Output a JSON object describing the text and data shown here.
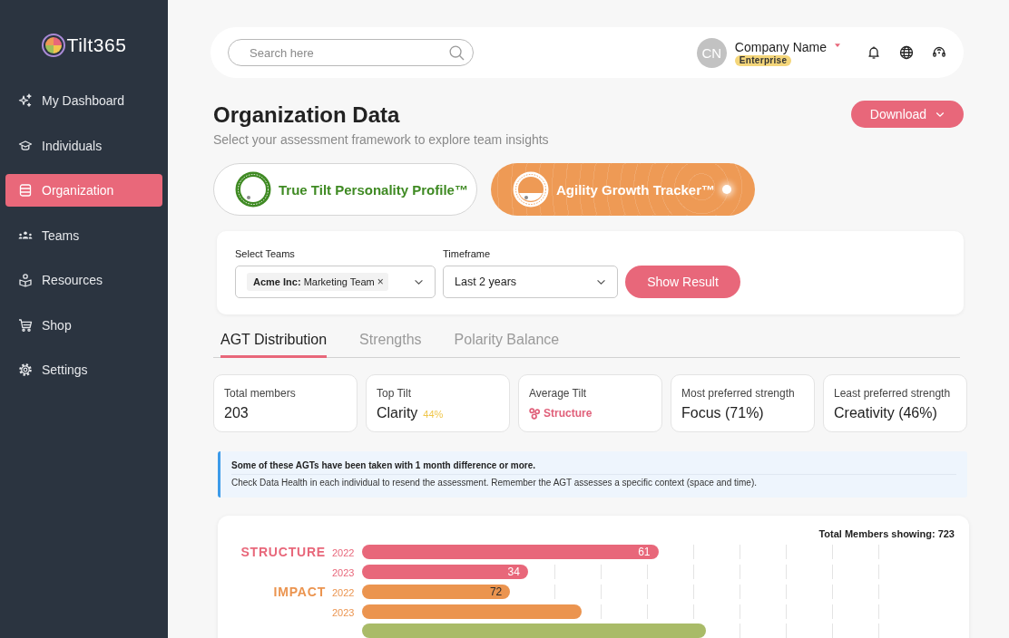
{
  "sidebar": {
    "logo": "Tilt365",
    "items": [
      {
        "label": "My Dashboard",
        "selected": false
      },
      {
        "label": "Individuals",
        "selected": false
      },
      {
        "label": "Organization",
        "selected": true
      },
      {
        "label": "Teams",
        "selected": false
      },
      {
        "label": "Resources",
        "selected": false
      },
      {
        "label": "Shop",
        "selected": false
      },
      {
        "label": "Settings",
        "selected": false
      }
    ]
  },
  "header": {
    "search": {
      "placeholder": "Search here"
    },
    "account": {
      "initials": "CN",
      "name": "Company Name",
      "plan": "Enterprise"
    }
  },
  "page": {
    "title": "Organization Data",
    "subtitle": "Select your assessment framework to explore team insights",
    "download": "Download"
  },
  "frameworks": [
    {
      "name": "True Tilt Personality Profile™",
      "color": "#3f8a23",
      "selected": false
    },
    {
      "name": "Agility Growth Tracker™",
      "color": "#ee9a55",
      "selected": true
    }
  ],
  "filters": {
    "teams": {
      "label": "Select Teams",
      "chips": [
        {
          "text": "**Acme Inc:** Marketing Team",
          "remove": "×"
        }
      ]
    },
    "timeframe": {
      "label": "Timeframe",
      "value": "Last 2 years"
    },
    "submit": "Show Result"
  },
  "tabs": [
    {
      "label": "AGT Distribution",
      "selected": true
    },
    {
      "label": "Strengths",
      "selected": false
    },
    {
      "label": "Polarity Balance",
      "selected": false
    }
  ],
  "stats": [
    {
      "kind": "number",
      "label": "Total members",
      "value": "203"
    },
    {
      "kind": "percent",
      "label": "Top Tilt",
      "value": "Clarity",
      "extra": "44%"
    },
    {
      "kind": "tag",
      "label": "Average Tilt",
      "value": "Structure"
    },
    {
      "kind": "number",
      "label": "Most preferred strength",
      "value": "Focus (71%)"
    },
    {
      "kind": "number",
      "label": "Least preferred strength",
      "value": "Creativity (46%)"
    }
  ],
  "notice": {
    "title": "Some of these AGTs have been taken with 1 month difference or more.",
    "body": "Check Data Health in each individual to resend the assessment. Remember the AGT assesses a specific context (space and time)."
  },
  "distribution": {
    "total": "Total Members showing: 723",
    "groups": [
      {
        "name": "STRUCTURE",
        "color": "#e8677a",
        "bars": [
          {
            "year": "2022",
            "level": 0.5,
            "value": "61"
          },
          {
            "year": "2023",
            "level": 0.28,
            "value": "34"
          }
        ]
      },
      {
        "name": "IMPACT",
        "color": "#eb944f",
        "bars": [
          {
            "year": "2022",
            "level": 0.25,
            "value": "72"
          },
          {
            "year": "2023",
            "level": 0.37
          }
        ]
      },
      {
        "color": "#a9bb68",
        "bars": [
          {
            "level": 0.58
          }
        ]
      }
    ]
  }
}
